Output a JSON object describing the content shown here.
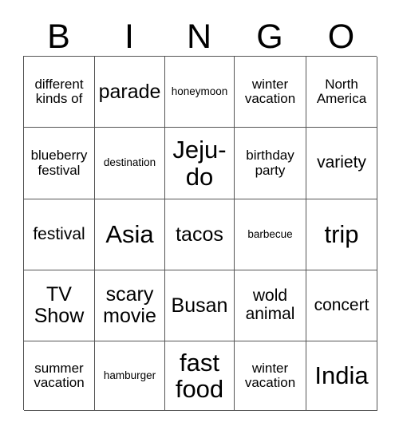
{
  "card": {
    "type": "bingo-card",
    "size": "5x5",
    "header_letters": [
      "B",
      "I",
      "N",
      "G",
      "O"
    ],
    "colors": {
      "background": "#ffffff",
      "text": "#000000",
      "grid_line": "#555555"
    },
    "columns": 5,
    "rows": 5,
    "cells": [
      [
        {
          "text": "different kinds of",
          "size": "fs-16"
        },
        {
          "text": "parade",
          "size": "fs-24"
        },
        {
          "text": "honeymoon",
          "size": "fs-13"
        },
        {
          "text": "winter vacation",
          "size": "fs-16"
        },
        {
          "text": "North America",
          "size": "fs-16"
        }
      ],
      [
        {
          "text": "blueberry festival",
          "size": "fs-16"
        },
        {
          "text": "destination",
          "size": "fs-13"
        },
        {
          "text": "Jeju-do",
          "size": "fs-30"
        },
        {
          "text": "birthday party",
          "size": "fs-16"
        },
        {
          "text": "variety",
          "size": "fs-20"
        }
      ],
      [
        {
          "text": "festival",
          "size": "fs-20"
        },
        {
          "text": "Asia",
          "size": "fs-30"
        },
        {
          "text": "tacos",
          "size": "fs-24"
        },
        {
          "text": "barbecue",
          "size": "fs-13"
        },
        {
          "text": "trip",
          "size": "fs-30"
        }
      ],
      [
        {
          "text": "TV Show",
          "size": "fs-24"
        },
        {
          "text": "scary movie",
          "size": "fs-24"
        },
        {
          "text": "Busan",
          "size": "fs-24"
        },
        {
          "text": "wold animal",
          "size": "fs-20"
        },
        {
          "text": "concert",
          "size": "fs-20"
        }
      ],
      [
        {
          "text": "summer vacation",
          "size": "fs-16"
        },
        {
          "text": "hamburger",
          "size": "fs-13"
        },
        {
          "text": "fast food",
          "size": "fs-30"
        },
        {
          "text": "winter vacation",
          "size": "fs-16"
        },
        {
          "text": "India",
          "size": "fs-30"
        }
      ]
    ]
  }
}
